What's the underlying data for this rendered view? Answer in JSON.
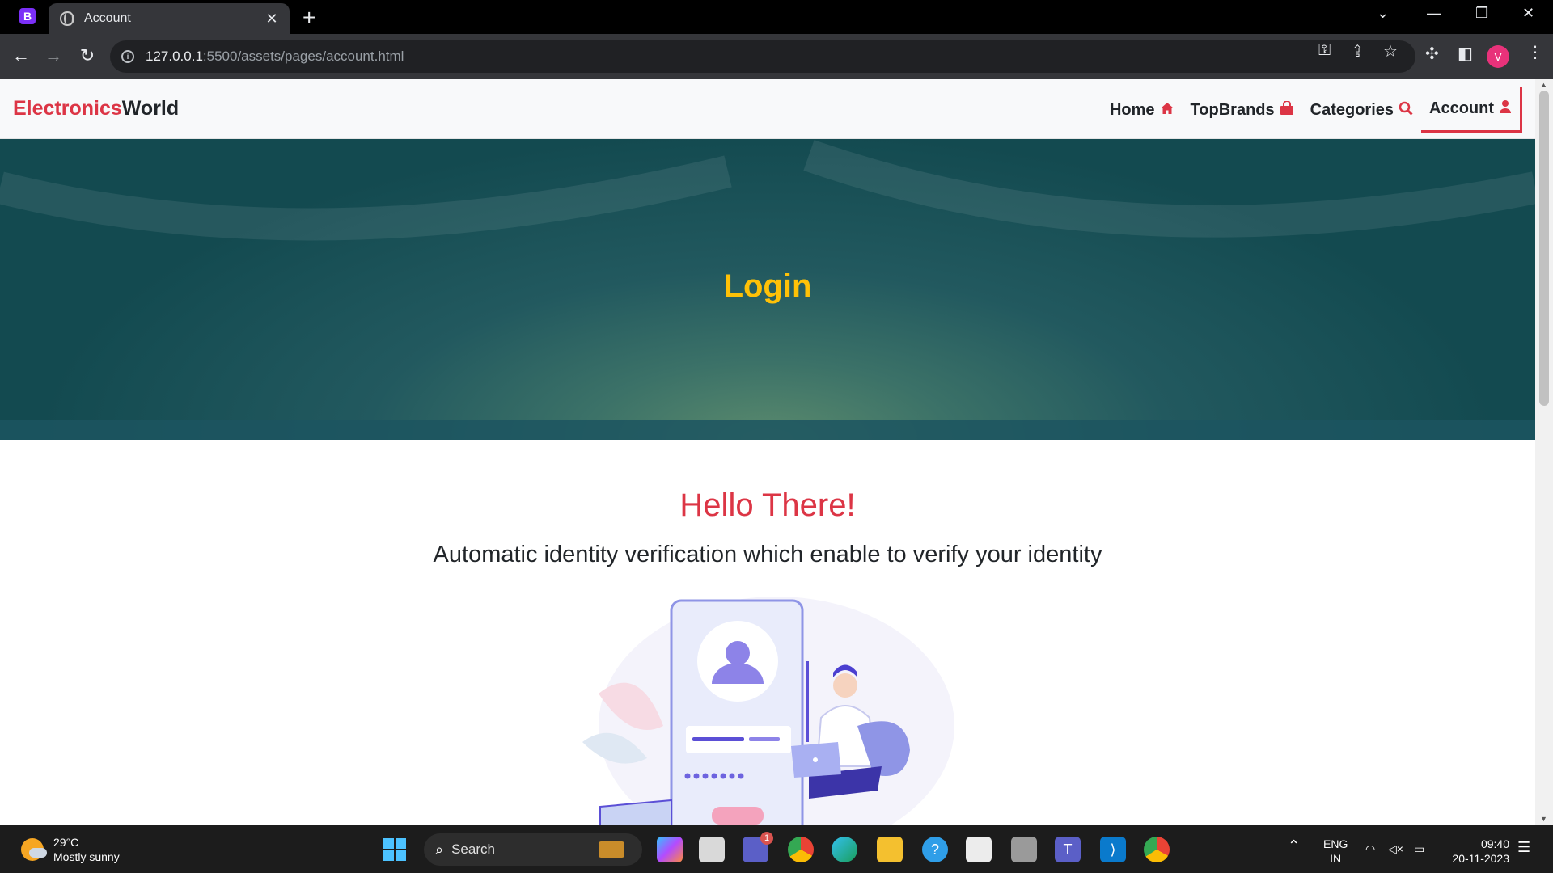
{
  "browser": {
    "app_badge": "B",
    "tab_title": "Account",
    "tab_close": "✕",
    "new_tab": "+",
    "url_host": "127.0.0.1",
    "url_rest": ":5500/assets/pages/account.html",
    "profile_initial": "V"
  },
  "navbar": {
    "brand_part1": "Electronics",
    "brand_part2": "World",
    "links": [
      {
        "label": "Home",
        "icon": "home-icon"
      },
      {
        "label": "TopBrands",
        "icon": "shopping-bag-icon"
      },
      {
        "label": "Categories",
        "icon": "search-icon"
      },
      {
        "label": "Account",
        "icon": "user-icon"
      }
    ]
  },
  "hero": {
    "title": "Login"
  },
  "main": {
    "heading": "Hello There!",
    "tagline": "Automatic identity verification which enable to verify your identity"
  },
  "taskbar": {
    "temperature": "29°C",
    "weather": "Mostly sunny",
    "search_label": "Search",
    "teams_badge": "1",
    "lang_1": "ENG",
    "lang_2": "IN",
    "time": "09:40",
    "date": "20-11-2023"
  },
  "colors": {
    "brand_red": "#dc3545",
    "hero_title": "#ffc107",
    "hero_bg": "#134a50"
  }
}
